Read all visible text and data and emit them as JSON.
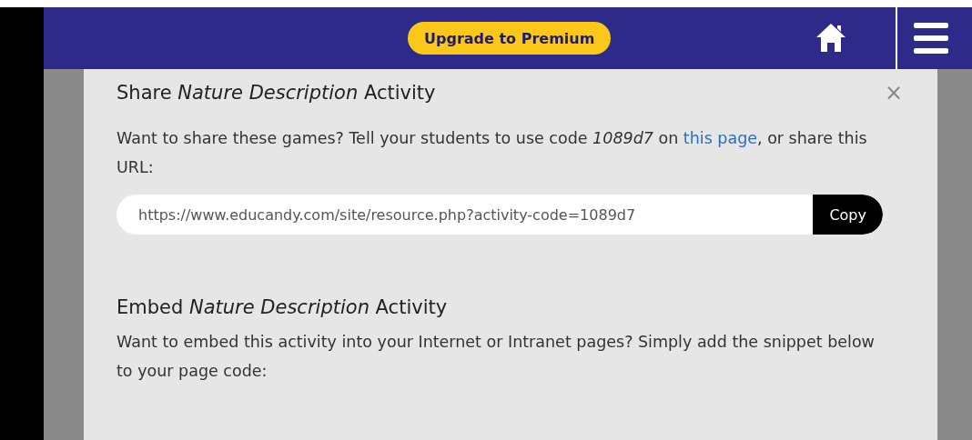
{
  "top_bar": {
    "upgrade_button": "Upgrade to Premium"
  },
  "share": {
    "title": "Share *Nature Description* Activity",
    "close": "×",
    "text_before": "Want to share these games? Tell your students to use code *1089d7* on ",
    "link": "this page",
    "text_after": ", or share this URL:",
    "url": "https://www.educandy.com/site/resource.php?activity-code=1089d7",
    "copy_button": "Copy"
  },
  "embed": {
    "title": "Embed *Nature Description* Activity",
    "text": "Want to embed this activity into your Internet or Intranet pages? Simply add the snippet below to your page code:"
  }
}
